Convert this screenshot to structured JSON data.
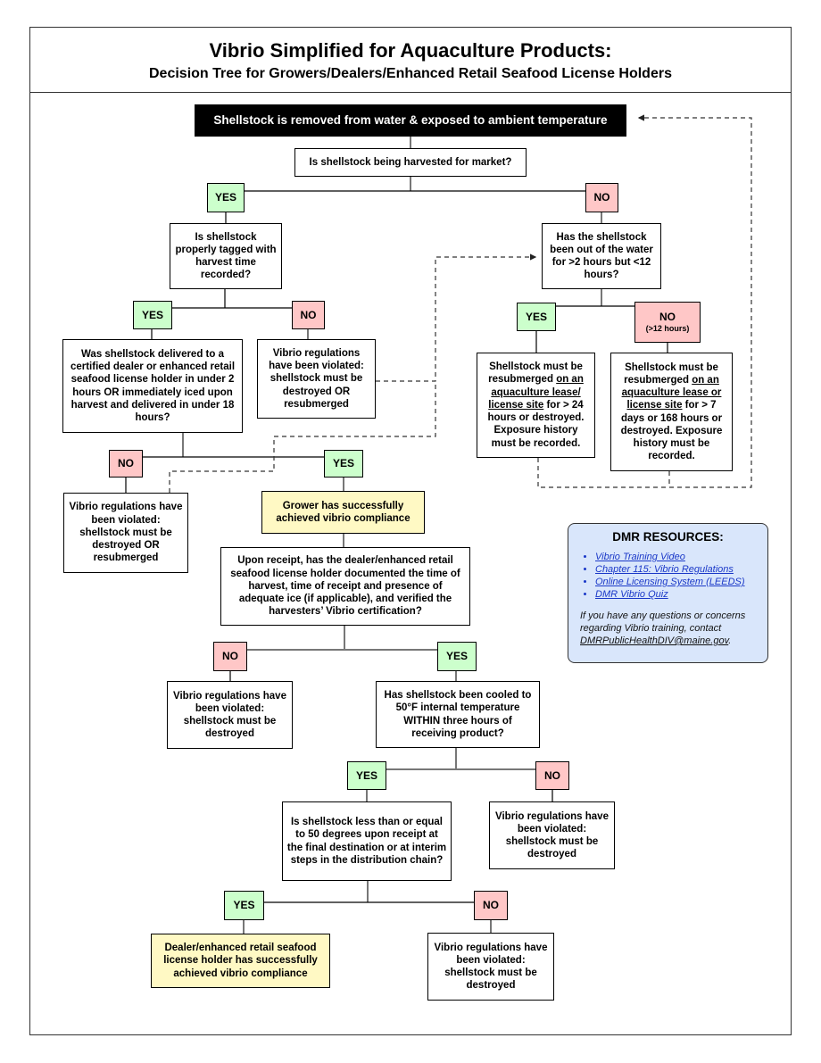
{
  "header": {
    "title": "Vibrio Simplified for Aquaculture Products:",
    "subtitle": "Decision Tree for Growers/Dealers/Enhanced Retail Seafood License Holders"
  },
  "colors": {
    "yes_fill": "#ccffcc",
    "no_fill": "#ffc7c7",
    "compliance_fill": "#fff9c4",
    "start_fill": "#000000",
    "resources_fill": "#d9e6fb",
    "link_color": "#1a38c8"
  },
  "nodes": {
    "start": "Shellstock is removed from water & exposed to ambient temperature",
    "q_market": "Is shellstock being harvested for market?",
    "q_tagged": "Is shellstock properly tagged with harvest time recorded?",
    "q_out_of_water": "Has the shellstock been out of the water for >2 hours but <12 hours?",
    "q_delivered": "Was shellstock delivered to a certified dealer or enhanced retail seafood license holder in under 2 hours OR immediately iced upon harvest and delivered in under 18 hours?",
    "violated_resubmerge_1": "Vibrio regulations have been violated: shellstock must be destroyed OR resubmerged",
    "resubmerge_24": {
      "pre": "Shellstock must be resubmerged ",
      "underlined": "on an aquaculture lease/ license site",
      "post": " for > 24 hours or destroyed. Exposure history must be recorded."
    },
    "resubmerge_168": {
      "pre": "Shellstock must be resubmerged ",
      "underlined": "on an aquaculture lease or license site",
      "post": " for > 7 days or 168 hours or destroyed. Exposure history must be recorded."
    },
    "violated_resubmerge_2": "Vibrio regulations have been violated: shellstock must be destroyed OR resubmerged",
    "grower_compliance": "Grower has successfully achieved vibrio compliance",
    "q_receipt": "Upon receipt, has the dealer/enhanced retail seafood license holder documented the time of harvest, time of receipt and presence of adequate ice (if applicable), and verified the harvesters’ Vibrio certification?",
    "violated_destroy_1": "Vibrio regulations have been violated: shellstock must be destroyed",
    "q_cooled": "Has shellstock been cooled to 50°F internal temperature WITHIN three hours of receiving product?",
    "violated_destroy_2": "Vibrio regulations have been violated: shellstock must be destroyed",
    "q_less_50": "Is shellstock less than or equal to 50 degrees upon receipt at the final destination or at interim steps in the distribution chain?",
    "dealer_compliance": "Dealer/enhanced retail seafood license holder has successfully achieved vibrio compliance",
    "violated_destroy_3": "Vibrio regulations have been violated: shellstock must be destroyed"
  },
  "labels": {
    "yes": "YES",
    "no": "NO",
    "no_over_12_sub": "(>12 hours)"
  },
  "resources": {
    "title": "DMR RESOURCES:",
    "links": [
      "Vibrio Training Video",
      "Chapter 115: Vibrio Regulations",
      "Online Licensing System (LEEDS)",
      "DMR Vibrio Quiz"
    ],
    "note": "If you have any questions or concerns regarding Vibrio training, contact ",
    "email": "DMRPublicHealthDIV@maine.gov",
    "note_end": "."
  }
}
